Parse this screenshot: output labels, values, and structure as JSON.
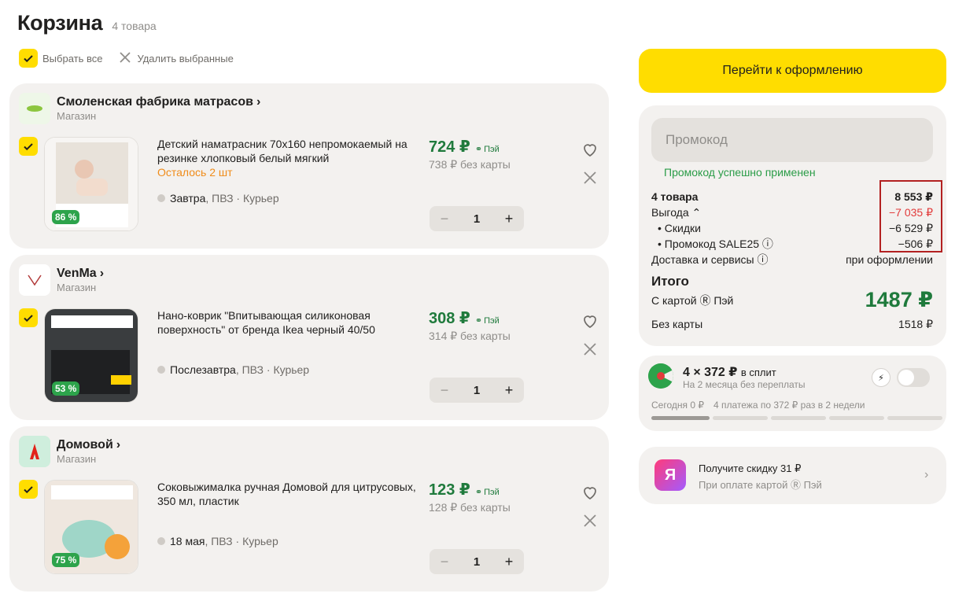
{
  "header": {
    "title": "Корзина",
    "count": "4 товара"
  },
  "actions": {
    "select_all": "Выбрать все",
    "delete_selected": "Удалить выбранные"
  },
  "stores": [
    {
      "name": "Смоленская фабрика матрасов",
      "sub": "Магазин",
      "item": {
        "name": "Детский наматрасник 70х160 непромокаемый на резинке хлопковый белый мягкий",
        "stock": "Осталось 2 шт",
        "badge": "86 %",
        "delivery_day": "Завтра",
        "delivery_rest": ", ПВЗ · Курьер",
        "price": "724 ₽",
        "pay": "Пэй",
        "old": "738 ₽ без карты",
        "qty": "1"
      }
    },
    {
      "name": "VenMa",
      "sub": "Магазин",
      "item": {
        "name": "Нано-коврик \"Впитывающая силиконовая поверхность\" от бренда Ikea черный 40/50",
        "stock": "",
        "badge": "53 %",
        "delivery_day": "Послезавтра",
        "delivery_rest": ", ПВЗ · Курьер",
        "price": "308 ₽",
        "pay": "Пэй",
        "old": "314 ₽ без карты",
        "qty": "1"
      }
    },
    {
      "name": "Домовой",
      "sub": "Магазин",
      "item": {
        "name": "Соковыжималка ручная Домовой для цитрусовых, 350 мл, пластик",
        "stock": "",
        "badge": "75 %",
        "delivery_day": "18 мая",
        "delivery_rest": ", ПВЗ · Курьер",
        "price": "123 ₽",
        "pay": "Пэй",
        "old": "128 ₽ без карты",
        "qty": "1"
      }
    }
  ],
  "checkout": {
    "label": "Перейти к оформлению"
  },
  "summary": {
    "promo_placeholder": "Промокод",
    "promo_ok": "Промокод успешно применен",
    "items_label": "4 товара",
    "items_value": "8 553 ₽",
    "benefit_label": "Выгода ⌃",
    "benefit_value": "−7 035 ₽",
    "discounts_label": "• Скидки",
    "discounts_value": "−6 529 ₽",
    "promo_label": "• Промокод SALE25 ⓘ",
    "promo_value": "−506 ₽",
    "delivery_label": "Доставка и сервисы ⓘ",
    "delivery_value": "при оформлении",
    "total_label": "Итого",
    "with_card_label": "С картой Ⓡ Пэй",
    "with_card_value": "1487 ₽",
    "no_card_label": "Без карты",
    "no_card_value": "1518 ₽"
  },
  "split": {
    "title": "4 × 372 ₽",
    "title_suffix": "в сплит",
    "sub": "На 2 месяца без переплаты",
    "today": "Сегодня 0 ₽",
    "schedule": "4 платежа по 372 ₽ раз в 2 недели"
  },
  "discount": {
    "logo": "Я",
    "title": "Получите скидку 31 ₽",
    "sub": "При оплате картой Ⓡ Пэй"
  }
}
